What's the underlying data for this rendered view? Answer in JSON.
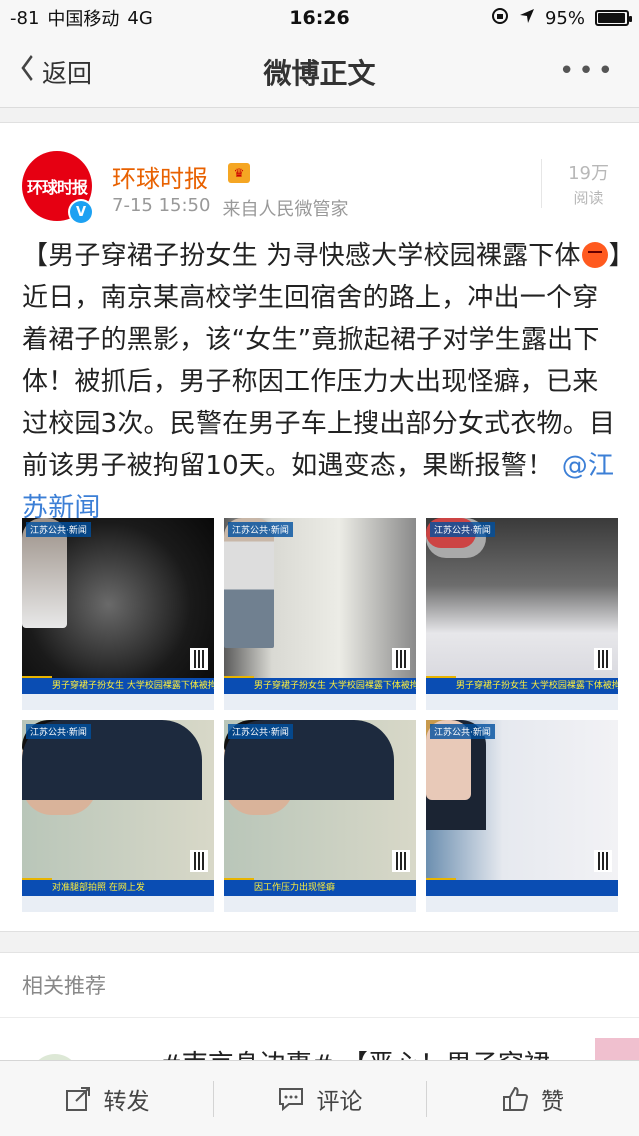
{
  "status_bar": {
    "signal": "-81",
    "carrier": "中国移动",
    "network": "4G",
    "time": "16:26",
    "battery": "95%",
    "battery_level": 0.95
  },
  "nav": {
    "back_label": "返回",
    "title": "微博正文",
    "more_label": "•••"
  },
  "post": {
    "author": "环球时报",
    "avatar_text": "环球时报",
    "time": "7-15 15:50",
    "source": "来自人民微管家",
    "reads_count": "19万",
    "reads_label": "阅读",
    "text_part1": "【男子穿裙子扮女生 为寻快感大学校园裸露下体",
    "text_part2": "】近日，南京某高校学生回宿舍的路上，冲出一个穿着裙子的黑影，该“女生”竟掀起裙子对学生露出下体！被抓后，男子称因工作压力大出现怪癖，已来过校园3次。民警在男子车上搜出部分女式衣物。目前该男子被拘留10天。如遇变态，果断报警！",
    "mention": "@江苏新闻",
    "emoji_icon": "angry-face-icon",
    "images": [
      {
        "tag": "江苏公共·新闻",
        "ticker": "男子穿裙子扮女生 大学校园裸露下体被拘"
      },
      {
        "tag": "江苏公共·新闻",
        "ticker": "男子穿裙子扮女生 大学校园裸露下体被拘"
      },
      {
        "tag": "江苏公共·新闻",
        "ticker": "男子穿裙子扮女生 大学校园裸露下体被拘"
      },
      {
        "tag": "江苏公共·新闻",
        "ticker": "对准腿部拍照 在网上发"
      },
      {
        "tag": "江苏公共·新闻",
        "ticker": "因工作压力出现怪癖"
      },
      {
        "tag": "江苏公共·新闻",
        "ticker": ""
      }
    ]
  },
  "related": {
    "header": "相关推荐",
    "item_text": "#南京身边事# 【恶心！男子穿裙"
  },
  "bottom_bar": {
    "repost": "转发",
    "comment": "评论",
    "like": "赞"
  },
  "colors": {
    "author": "#e86100",
    "mention": "#3c7fd6",
    "avatar": "#e60012",
    "ticker": "#0a4db3"
  }
}
